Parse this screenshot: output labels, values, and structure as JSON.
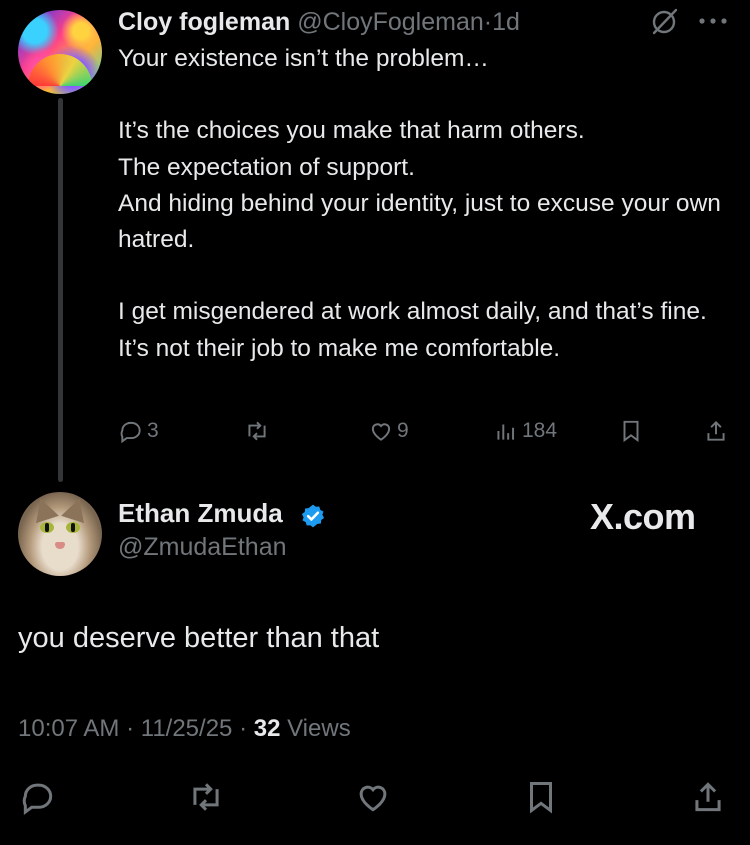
{
  "tweet": {
    "author_name": "Cloy fogleman",
    "author_handle": "@CloyFogleman",
    "separator": "·",
    "time": "1d",
    "lines": [
      "Your existence isn’t the problem…",
      "",
      "It’s the choices you make that harm others.",
      "The expectation of support.",
      "And hiding behind your identity, just to excuse your own hatred.",
      "",
      "I get misgendered at work almost daily, and that’s fine.",
      "It’s not their job to make me comfortable."
    ],
    "replies": "3",
    "reposts": "",
    "likes": "9",
    "views": "184"
  },
  "reply": {
    "author_name": "Ethan Zmuda",
    "author_handle": "@ZmudaEthan",
    "brand": "X.com",
    "text": "you deserve better than that",
    "time": "10:07 AM",
    "date": "11/25/25",
    "separator": "·",
    "views_count": "32",
    "views_label": "Views"
  },
  "colors": {
    "background": "#000000",
    "text": "#e7e9ea",
    "muted": "#71767b",
    "verified": "#1d9bf0",
    "thread_line": "#333639"
  }
}
